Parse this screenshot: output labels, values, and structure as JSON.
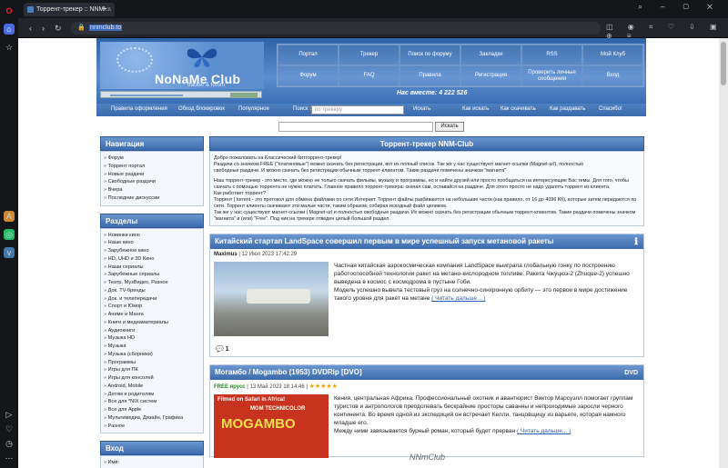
{
  "browser": {
    "tab_title": "Торрент-трекер :: NNM-...",
    "url": "nnmclub.to",
    "new_tab": "+"
  },
  "header": {
    "logo_title": "NoNaMe Club",
    "logo_sub": "tracker & forum",
    "menu": [
      "Портал",
      "Трекер",
      "Поиск по форуму",
      "Закладки",
      "RSS",
      "Мой Клуб",
      "Форум",
      "FAQ",
      "Правила",
      "Регистрация",
      "Проверить личные сообщения",
      "Вход"
    ],
    "onsite": "Нас вместе: 4 222 526"
  },
  "subnav": {
    "items": [
      "Правила оформления",
      "Обход блокировок",
      "Популярное"
    ],
    "search_label": "Поиск :",
    "search_placeholder": "по трекеру",
    "search_btn": "Искать",
    "right": [
      "Как искать",
      "Как скачивать",
      "Как раздавать",
      "Спасибо!"
    ]
  },
  "search": {
    "button": "Искать"
  },
  "sidebar": {
    "nav_title": "Навигация",
    "nav_items": [
      "Форум",
      "Торрент портал",
      "Новые раздачи",
      "Свободные раздачи",
      "Вчера",
      "Последние дискуссии"
    ],
    "sections_title": "Разделы",
    "sections": [
      "Новинки кино",
      "Наше кино",
      "Зарубежное кино",
      "HD, UHD и 3D Кино",
      "Наши сериалы",
      "Зарубежные сериалы",
      "Театр, МузВидео, Разное",
      "Док. TV-бренды",
      "Док. и телепередачи",
      "Спорт и Юмор",
      "Аниме и Манга",
      "Книги и медиаматериалы",
      "Аудиокниги",
      "Музыка HD",
      "Музыка",
      "Музыка (сборники)",
      "Программы",
      "Игры для ПК",
      "Игры для консолей",
      "Android, Mobile",
      "Детям и родителям",
      "Все для *NIX систем",
      "Все для Apple",
      "Мультимедиа, Дизайн, Графика",
      "Разное"
    ],
    "login_title": "Вход",
    "login_item": "Имя:"
  },
  "intro": {
    "title": "Торрент-трекер NNM-Club",
    "lines": [
      "Добро пожаловать на Классический битторрент-трекер!",
      "Раздачи со значком FREE (\"платиновые\") можно скачать без регистрации, вот их полный список. Так же у нас существуют магнет-ссылки (Magnet-url), полностью",
      "свободные раздачи. И можно скачать без регистрации обычным торрент-клиентом. Такие раздачи помечены значком \"магнита\"",
      "Наш торрент-трекер - это место, где можно не только скачать фильмы, музыку и программы, но и найти друзей или просто пообщаться на интересующие Вас темы. Для того, чтобы скачать с помощью торрента не нужно платить. Главное правило торрент-трекера: скачал сам, оставайся на раздаче. Для этого просто не надо удалять торрент из клиента.",
      "Как работает торрент?",
      "Торрент | torrent - это протокол для обмена файлами по сети Интернет. Торрент файлы разбиваются на небольшие части (как правило, от 16 до 4096 Кб), которые затем передаются по сети. Торрент клиенты скачивают эти малые части, таким образом, собирая исходный файл целиком.",
      "Так же у нас существуют магнет-ссылки | Magnet-url и полностью свободные раздачи. Их можно скачать без регистрации обычным торрент-клиентом. Такие раздачи помечены значком \"магнита\" и (или) \"Free\". Под ник на трекере отведен целый большой раздел."
    ]
  },
  "news": [
    {
      "title": "Китайский стартап LandSpace совершил первым в мире успешный запуск метановой ракеты",
      "author": "Maximus",
      "date": "| 12 Июл 2023 17:42:29",
      "text": "Частная китайская аэрокосмическая компания LandSpace выиграла глобальную гонку по построению работоспособной технологии ракет на метано-кислородном топливе. Ракета Чжуцюэ-2 (Zhuque-2) успешно выведена в космос с космодрома в пустыне Гоби.",
      "text2": "Модель успешно вывела тестовый груз на солнечно-синхронную орбиту — это первое в мире достижение такого уровня для ракет на метане",
      "more": "( Читать дальше... )",
      "comments": "1"
    },
    {
      "title": "Могамбо / Mogambo (1953) DVDRip [DVO]",
      "author": "FREE ярусс",
      "date": "| 13 Май 2023 18:14:46 |",
      "stars": "★★★★★",
      "poster_top": "Filmed on Safari in Africa!",
      "poster_mid": "MGM TECHNICOLOR",
      "poster_title": "MOGAMBO",
      "text": "Кения, центральная Африка. Профессиональный охотник и авантюрист Виктор Марсуэлл помогает группам туристов и антропологов преодолевать бескрайние просторы саванны и непроходимые заросли черного континента. Во время одной из экспедиций он встречает Келли, танцовщицу из варьете, которая намного младше его.",
      "text2": "Между ними завязывается бурный роман, который будет прерван",
      "more": "( Читать дальше... )"
    }
  ],
  "watermark": "NNmClub"
}
